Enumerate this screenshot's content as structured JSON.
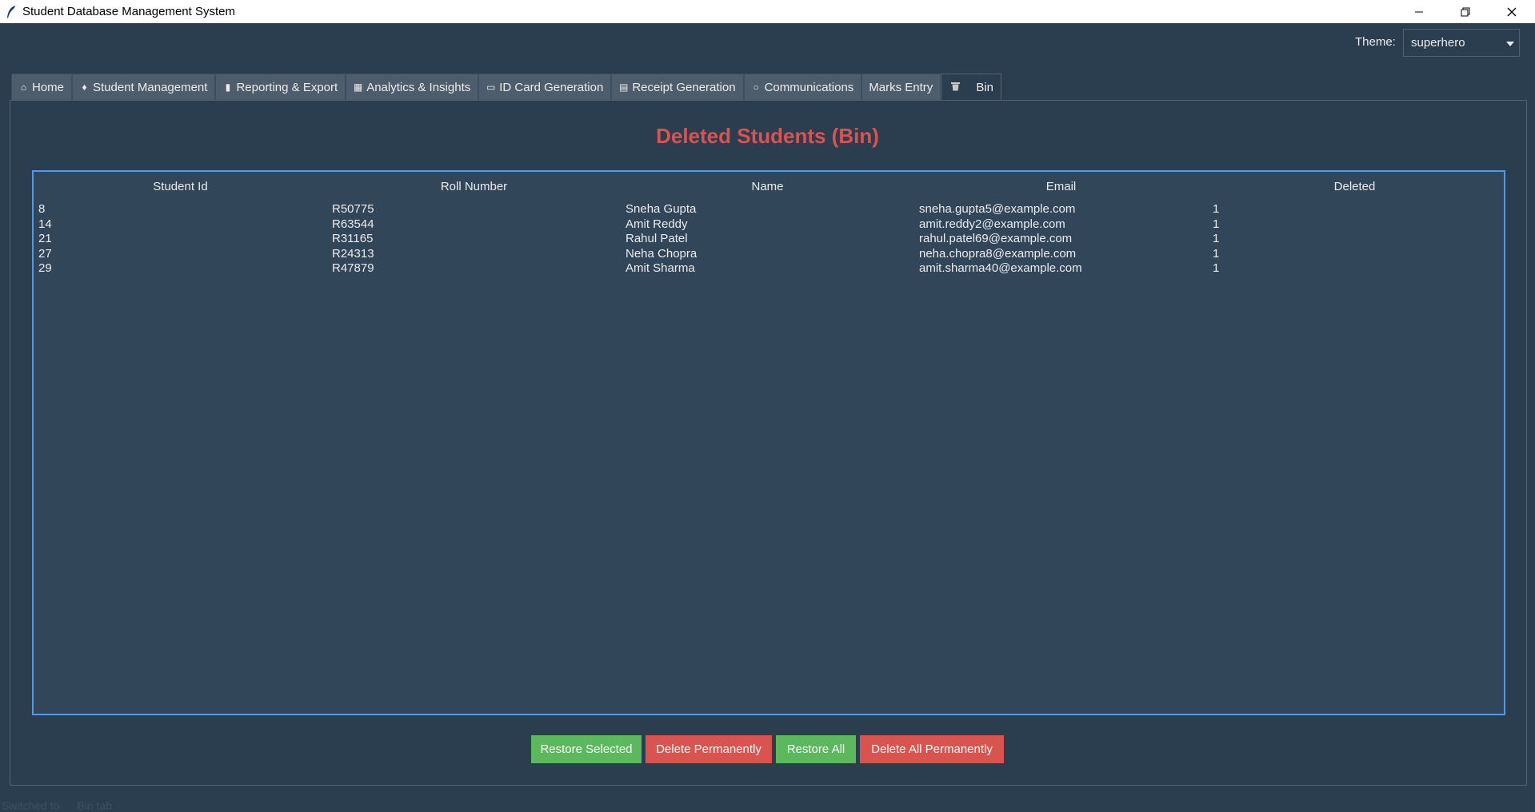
{
  "window": {
    "title": "Student Database Management System"
  },
  "theme": {
    "label": "Theme:",
    "value": "superhero"
  },
  "tabs": [
    {
      "label": "Home",
      "icon": "home-icon"
    },
    {
      "label": "Student Management",
      "icon": "graduation-cap-icon"
    },
    {
      "label": "Reporting & Export",
      "icon": "report-icon"
    },
    {
      "label": "Analytics & Insights",
      "icon": "chart-icon"
    },
    {
      "label": "ID Card Generation",
      "icon": "id-card-icon"
    },
    {
      "label": "Receipt Generation",
      "icon": "receipt-icon"
    },
    {
      "label": "Communications",
      "icon": "speech-bubble-icon"
    },
    {
      "label": "Marks Entry",
      "icon": ""
    },
    {
      "label": "Bin",
      "icon": "trash-icon"
    }
  ],
  "page": {
    "title": "Deleted Students (Bin)"
  },
  "table": {
    "columns": [
      "Student Id",
      "Roll Number",
      "Name",
      "Email",
      "Deleted"
    ],
    "rows": [
      [
        "8",
        "R50775",
        "Sneha Gupta",
        "sneha.gupta5@example.com",
        "1"
      ],
      [
        "14",
        "R63544",
        "Amit Reddy",
        "amit.reddy2@example.com",
        "1"
      ],
      [
        "21",
        "R31165",
        "Rahul Patel",
        "rahul.patel69@example.com",
        "1"
      ],
      [
        "27",
        "R24313",
        "Neha Chopra",
        "neha.chopra8@example.com",
        "1"
      ],
      [
        "29",
        "R47879",
        "Amit Sharma",
        "amit.sharma40@example.com",
        "1"
      ]
    ]
  },
  "buttons": {
    "restore_selected": "Restore Selected",
    "delete_permanently": "Delete Permanently",
    "restore_all": "Restore All",
    "delete_all_permanently": "Delete All Permanently"
  },
  "status": {
    "text_left": "Switched to",
    "text_right": "Bin tab"
  },
  "colors": {
    "background": "#2b3e50",
    "accent_red": "#d9534f",
    "accent_green": "#5cb85c",
    "table_border": "#4c9be8"
  }
}
